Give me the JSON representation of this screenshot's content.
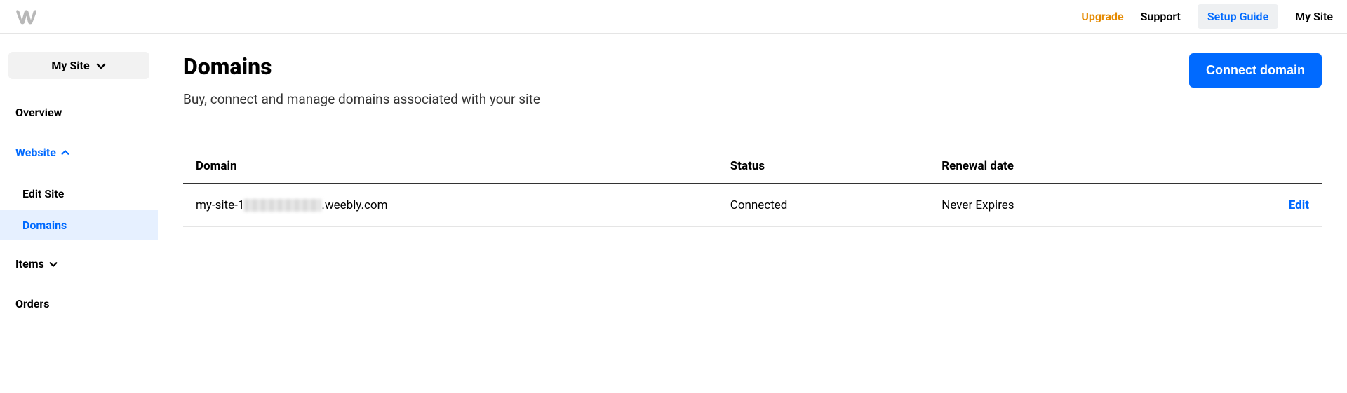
{
  "topnav": {
    "upgrade": "Upgrade",
    "support": "Support",
    "setup_guide": "Setup Guide",
    "my_site": "My Site"
  },
  "sidebar": {
    "selector_label": "My Site",
    "overview": "Overview",
    "website": "Website",
    "edit_site": "Edit Site",
    "domains": "Domains",
    "items": "Items",
    "orders": "Orders"
  },
  "page": {
    "title": "Domains",
    "subtitle": "Buy, connect and manage domains associated with your site",
    "connect_button": "Connect domain"
  },
  "table": {
    "headers": {
      "domain": "Domain",
      "status": "Status",
      "renewal": "Renewal date"
    },
    "rows": [
      {
        "domain_prefix": "my-site-1",
        "domain_suffix": ".weebly.com",
        "status": "Connected",
        "renewal": "Never Expires",
        "action": "Edit"
      }
    ]
  }
}
